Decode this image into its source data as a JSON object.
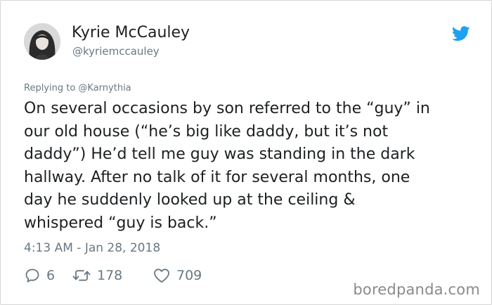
{
  "author": {
    "display_name": "Kyrie McCauley",
    "handle": "@kyriemccauley"
  },
  "icons": {
    "brand": "twitter-bird-icon",
    "reply": "reply-icon",
    "retweet": "retweet-icon",
    "like": "heart-icon"
  },
  "colors": {
    "twitter_blue": "#1da1f2",
    "text": "#1c2022",
    "muted": "#697882"
  },
  "reply_context": "Replying to @Karnythia",
  "tweet": {
    "lines": [
      "On several occasions by son referred to the “guy” in",
      "our old house (“he’s big like daddy, but it’s not",
      "daddy”) He’d tell me guy was standing in the dark",
      "hallway. After no talk of it for several months, one",
      "day he suddenly looked up at the ceiling &",
      "whispered “guy is back.”"
    ],
    "timestamp": "4:13 AM - Jan 28, 2018"
  },
  "stats": {
    "replies": "6",
    "retweets": "178",
    "likes": "709"
  },
  "watermark": "boredpanda.com"
}
